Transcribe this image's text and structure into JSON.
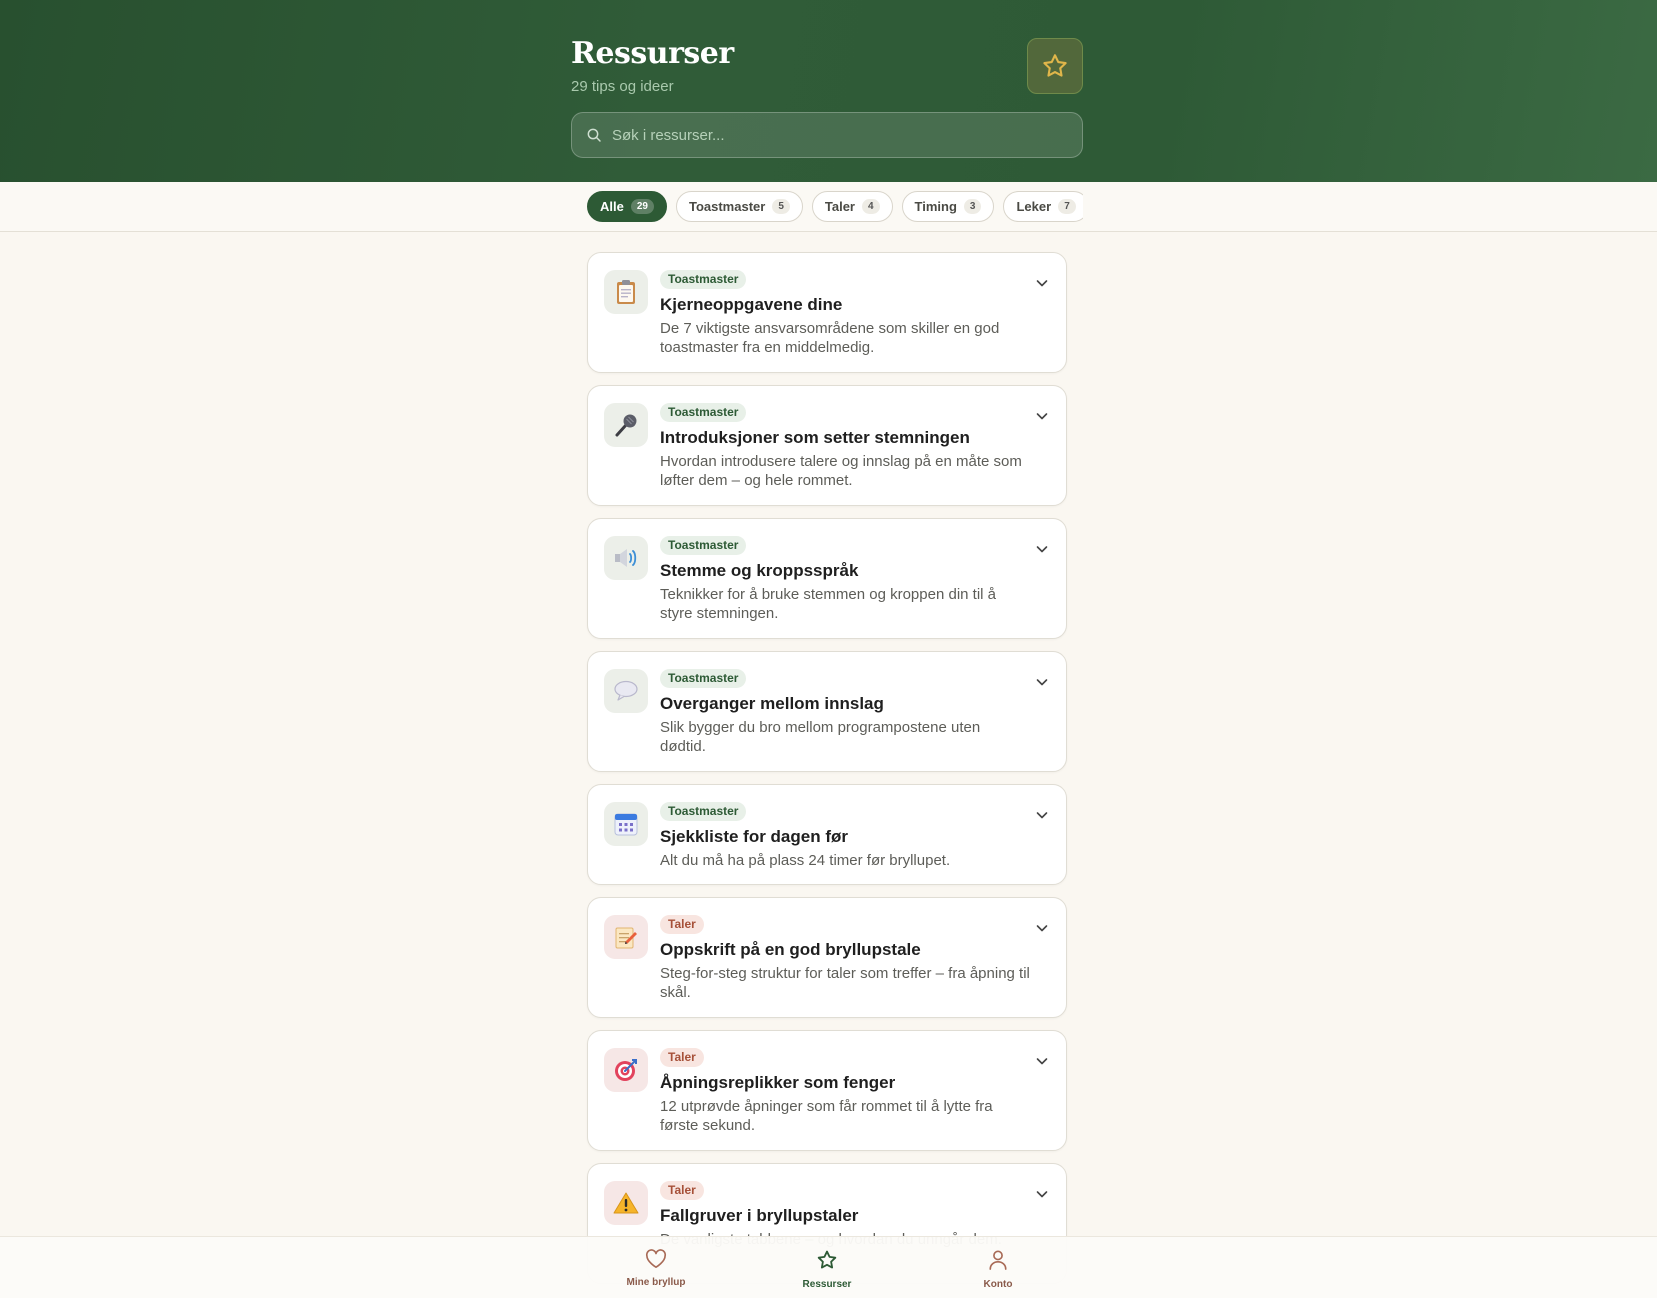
{
  "header": {
    "title": "Ressurser",
    "subtitle": "29 tips og ideer",
    "favorites_icon": "star-icon"
  },
  "search": {
    "placeholder": "Søk i ressurser...",
    "value": ""
  },
  "filters": [
    {
      "label": "Alle",
      "count": "29",
      "active": true
    },
    {
      "label": "Toastmaster",
      "count": "5",
      "active": false
    },
    {
      "label": "Taler",
      "count": "4",
      "active": false
    },
    {
      "label": "Timing",
      "count": "3",
      "active": false
    },
    {
      "label": "Leker",
      "count": "7",
      "active": false
    }
  ],
  "resources": [
    {
      "icon": "clipboard-icon",
      "tag": "Toastmaster",
      "title": "Kjerneoppgavene dine",
      "description": "De 7 viktigste ansvarsområdene som skiller en god toastmaster fra en middelmedig."
    },
    {
      "icon": "microphone-icon",
      "tag": "Toastmaster",
      "title": "Introduksjoner som setter stemningen",
      "description": "Hvordan introdusere talere og innslag på en måte som løfter dem – og hele rommet."
    },
    {
      "icon": "speaker-icon",
      "tag": "Toastmaster",
      "title": "Stemme og kroppsspråk",
      "description": "Teknikker for å bruke stemmen og kroppen din til å styre stemningen."
    },
    {
      "icon": "speech-bubble-icon",
      "tag": "Toastmaster",
      "title": "Overganger mellom innslag",
      "description": "Slik bygger du bro mellom programpostene uten dødtid."
    },
    {
      "icon": "calendar-icon",
      "tag": "Toastmaster",
      "title": "Sjekkliste for dagen før",
      "description": "Alt du må ha på plass 24 timer før bryllupet."
    },
    {
      "icon": "memo-icon",
      "tag": "Taler",
      "title": "Oppskrift på en god bryllupstale",
      "description": "Steg-for-steg struktur for taler som treffer – fra åpning til skål."
    },
    {
      "icon": "target-icon",
      "tag": "Taler",
      "title": "Åpningsreplikker som fenger",
      "description": "12 utprøvde åpninger som får rommet til å lytte fra første sekund."
    },
    {
      "icon": "warning-icon",
      "tag": "Taler",
      "title": "Fallgruver i bryllupstaler",
      "description": "De vanligste tabbene – og hvordan du unngår dem."
    }
  ],
  "colors": {
    "header": "#2e5a36",
    "accent": "#2d5a35",
    "toastmaster_tag": "#e8f0e8",
    "taler_tag": "#f8e5e0",
    "background": "#faf7f1"
  },
  "bottom_nav": [
    {
      "label": "Mine bryllup",
      "icon": "heart-icon",
      "active": false
    },
    {
      "label": "Ressurser",
      "icon": "star-icon",
      "active": true
    },
    {
      "label": "Konto",
      "icon": "user-icon",
      "active": false
    }
  ]
}
